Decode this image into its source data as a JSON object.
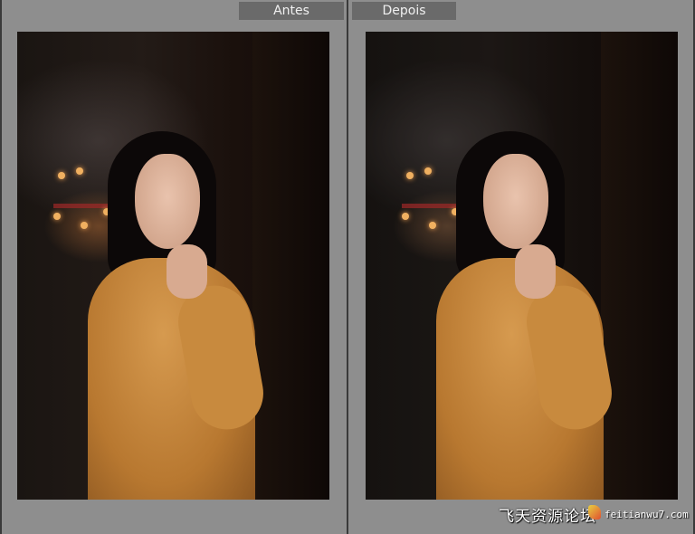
{
  "labels": {
    "before": "Antes",
    "after": "Depois"
  },
  "watermark": {
    "chinese": "飞天资源论坛",
    "url": "feitianwu7.com"
  },
  "colors": {
    "background": "#8e8e8e",
    "tab": "#6a6a6a"
  }
}
